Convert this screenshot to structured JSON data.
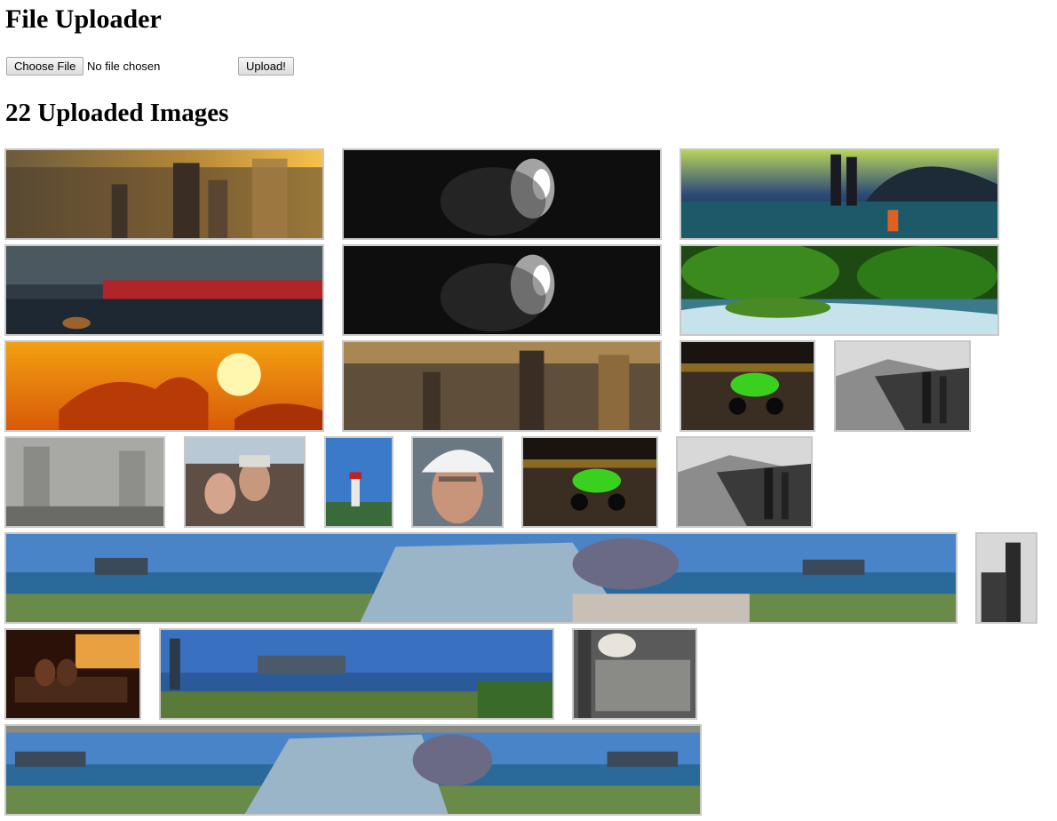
{
  "page": {
    "title": "File Uploader",
    "choose_file_label": "Choose File",
    "file_status": "No file chosen",
    "upload_label": "Upload!",
    "gallery_heading": "22 Uploaded Images"
  },
  "images": [
    {
      "name": "image-city-sunset-aerial"
    },
    {
      "name": "image-dark-nebula"
    },
    {
      "name": "image-cologne-bridge-night"
    },
    {
      "name": "image-train-on-bridge"
    },
    {
      "name": "image-dark-nebula-2"
    },
    {
      "name": "image-green-forest-stream"
    },
    {
      "name": "image-orange-sun-clouds"
    },
    {
      "name": "image-city-sunset-aerial-2"
    },
    {
      "name": "image-green-motorcycle-night"
    },
    {
      "name": "image-chicago-lakeshore-bw"
    },
    {
      "name": "image-rainy-window-city"
    },
    {
      "name": "image-couple-selfie"
    },
    {
      "name": "image-lighthouse"
    },
    {
      "name": "image-man-in-cap"
    },
    {
      "name": "image-green-motorcycle-night-2"
    },
    {
      "name": "image-chicago-lakeshore-bw-2"
    },
    {
      "name": "image-chicago-panorama-planetarium"
    },
    {
      "name": "image-bw-clock-tower"
    },
    {
      "name": "image-bench-night-couple"
    },
    {
      "name": "image-chicago-skyline-panorama"
    },
    {
      "name": "image-safety-shoes-sign"
    },
    {
      "name": "image-chicago-panorama-wide"
    }
  ]
}
